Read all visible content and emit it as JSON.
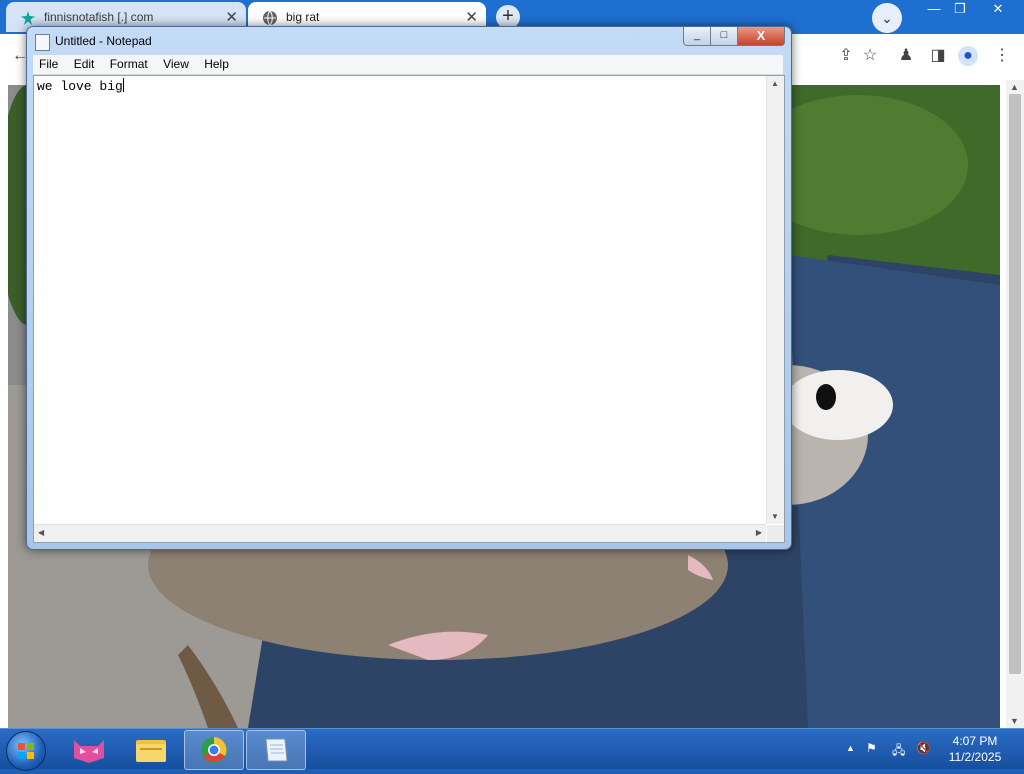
{
  "browser": {
    "tabs": [
      {
        "title": "finnisnotafish [.] com"
      },
      {
        "title": "big rat"
      }
    ],
    "new_tab_symbol": "+",
    "tab_search_symbol": "⌄",
    "window_controls": {
      "minimize": "—",
      "restore": "❐",
      "close": "✕"
    }
  },
  "notepad": {
    "title": "Untitled - Notepad",
    "menu": [
      "File",
      "Edit",
      "Format",
      "View",
      "Help"
    ],
    "text": "we love big",
    "controls": {
      "minimize": "_",
      "maximize": "□",
      "close": "X"
    }
  },
  "taskbar": {
    "clock_time": "4:07 PM",
    "clock_date": "11/2/2025",
    "tray_up_arrow": "▲"
  },
  "colors": {
    "taskbar": "#1f5ab0",
    "browser_tabstrip": "#1f6fd1",
    "notepad_frame": "#b4d0ef"
  }
}
